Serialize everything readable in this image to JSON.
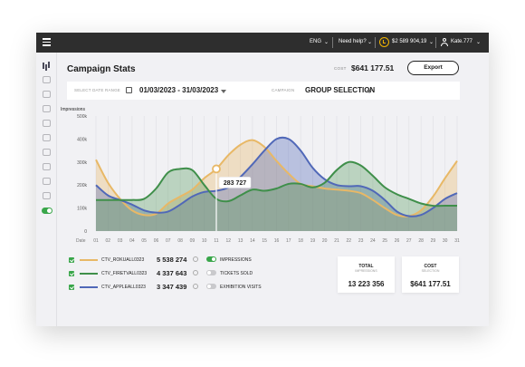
{
  "topbar": {
    "language": "ENG",
    "help": "Need help?",
    "balance": "$2 589 904,19",
    "user": "Kate.777"
  },
  "page": {
    "title": "Campaign Stats",
    "cost_label": "COST",
    "cost_value": "$641 177.51",
    "export_label": "Export"
  },
  "filters": {
    "date_range_label": "SELECT DATE RANGE",
    "date_range_value": "01/03/2023 - 31/03/2023",
    "campaign_label": "CAMPAIGN",
    "campaign_value": "GROUP SELECTION"
  },
  "chart_data": {
    "type": "area",
    "ylabel": "Impressions",
    "y_ticks": [
      "500k",
      "400k",
      "300k",
      "200k",
      "100k",
      "0"
    ],
    "ylim": [
      0,
      500000
    ],
    "x_prefix": "Date",
    "categories": [
      "01",
      "02",
      "03",
      "04",
      "05",
      "06",
      "07",
      "08",
      "09",
      "10",
      "11",
      "12",
      "13",
      "14",
      "15",
      "16",
      "17",
      "18",
      "19",
      "20",
      "21",
      "22",
      "23",
      "24",
      "25",
      "26",
      "27",
      "28",
      "29",
      "30",
      "31"
    ],
    "series": [
      {
        "name": "CTV_ROKUALL0323",
        "color": "#e8b866",
        "fill": "rgba(232,184,102,0.35)",
        "values": [
          310000,
          210000,
          140000,
          90000,
          70000,
          75000,
          120000,
          150000,
          180000,
          230000,
          270000,
          330000,
          375000,
          395000,
          365000,
          305000,
          250000,
          205000,
          195000,
          185000,
          180000,
          175000,
          165000,
          135000,
          100000,
          70000,
          65000,
          90000,
          150000,
          230000,
          305000
        ]
      },
      {
        "name": "CTV_FIRETVALL0323",
        "color": "#3f8f4a",
        "fill": "rgba(63,143,74,0.30)",
        "values": [
          135000,
          135000,
          135000,
          135000,
          140000,
          185000,
          255000,
          270000,
          265000,
          200000,
          140000,
          130000,
          155000,
          180000,
          175000,
          185000,
          205000,
          205000,
          190000,
          210000,
          265000,
          300000,
          285000,
          240000,
          190000,
          160000,
          140000,
          120000,
          110000,
          110000,
          110000
        ]
      },
      {
        "name": "CTV_APPLEALL0323",
        "color": "#5068b8",
        "fill": "rgba(80,104,184,0.35)",
        "values": [
          200000,
          155000,
          135000,
          115000,
          90000,
          80000,
          85000,
          115000,
          150000,
          170000,
          175000,
          190000,
          235000,
          290000,
          350000,
          400000,
          400000,
          350000,
          275000,
          225000,
          200000,
          195000,
          195000,
          175000,
          135000,
          85000,
          65000,
          70000,
          100000,
          140000,
          165000
        ]
      }
    ],
    "tooltip": {
      "x": "11",
      "series": "CTV_ROKUALL0323",
      "value": 283727,
      "label": "283 727"
    },
    "grid": "vertical"
  },
  "legend": [
    {
      "name": "CTV_ROKUALL0323",
      "value": "5 538 274",
      "toggle": "IMPRESSIONS",
      "on": true
    },
    {
      "name": "CTV_FIRETVALL0323",
      "value": "4 337 643",
      "toggle": "TICKETS SOLD",
      "on": false
    },
    {
      "name": "CTV_APPLEALL0323",
      "value": "3 347 439",
      "toggle": "EXHIBITION VISITS",
      "on": false
    }
  ],
  "cards": [
    {
      "title": "TOTAL",
      "subtitle": "IMPRESSIONS",
      "value": "13 223 356"
    },
    {
      "title": "COST",
      "subtitle": "SELECTION",
      "value": "$641 177.51"
    }
  ],
  "colors": {
    "accent": "#39a64a",
    "topbar": "#2e2e2e",
    "coin": "#f0b400"
  }
}
